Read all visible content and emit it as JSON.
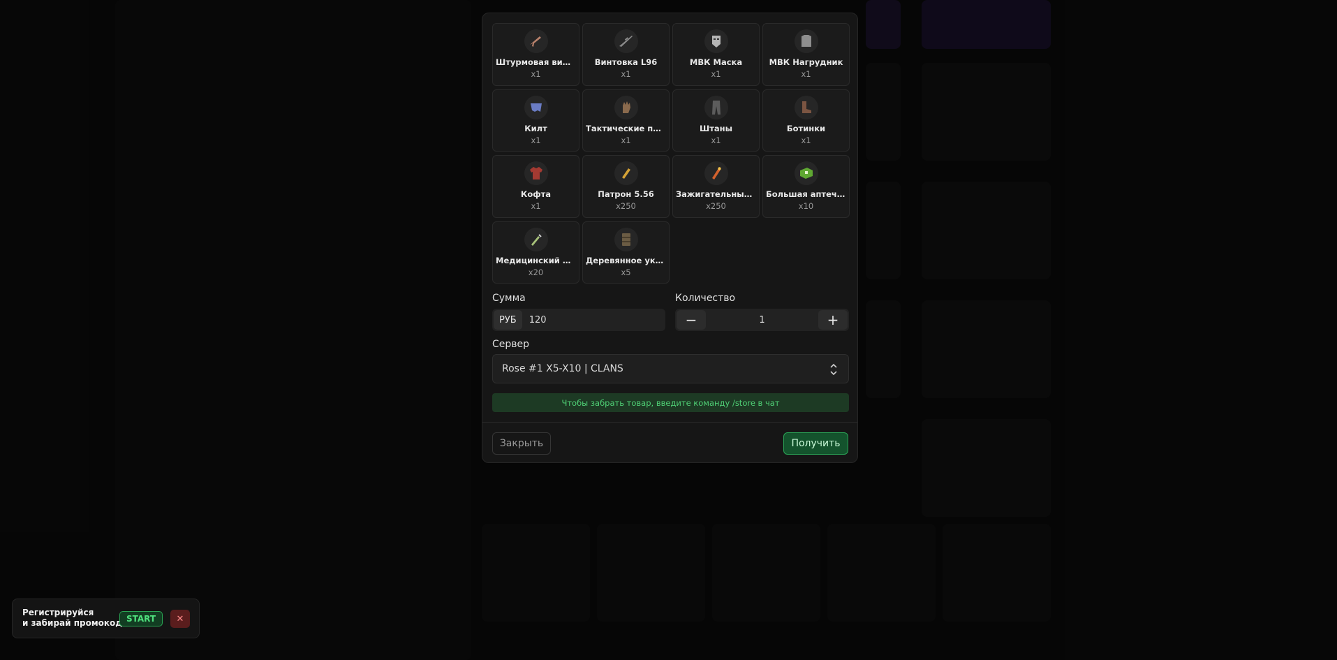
{
  "items": [
    {
      "name": "Штурмовая винто...",
      "qty": "x1",
      "icon": "rifle-icon",
      "color": "#b9826c"
    },
    {
      "name": "Винтовка L96",
      "qty": "x1",
      "icon": "sniper-rifle-icon",
      "color": "#8a8a8a"
    },
    {
      "name": "МВК Маска",
      "qty": "x1",
      "icon": "metal-mask-icon",
      "color": "#b5b5b5"
    },
    {
      "name": "МВК Нагрудник",
      "qty": "x1",
      "icon": "chestplate-icon",
      "color": "#8e8e8e"
    },
    {
      "name": "Килт",
      "qty": "x1",
      "icon": "kilt-icon",
      "color": "#6a7cc4"
    },
    {
      "name": "Тактические пер...",
      "qty": "x1",
      "icon": "gloves-icon",
      "color": "#8a6a4d"
    },
    {
      "name": "Штаны",
      "qty": "x1",
      "icon": "pants-icon",
      "color": "#5c5c5c"
    },
    {
      "name": "Ботинки",
      "qty": "x1",
      "icon": "boots-icon",
      "color": "#7b5542"
    },
    {
      "name": "Кофта",
      "qty": "x1",
      "icon": "jacket-icon",
      "color": "#a43a32"
    },
    {
      "name": "Патрон 5.56",
      "qty": "x250",
      "icon": "ammo-icon",
      "color": "#d4a236"
    },
    {
      "name": "Зажигательный п...",
      "qty": "x250",
      "icon": "incendiary-ammo-icon",
      "color": "#d2612d"
    },
    {
      "name": "Большая аптечка",
      "qty": "x10",
      "icon": "medkit-icon",
      "color": "#5fa832"
    },
    {
      "name": "Медицинский шп...",
      "qty": "x20",
      "icon": "syringe-icon",
      "color": "#a8c27a"
    },
    {
      "name": "Деревянное укр...",
      "qty": "x5",
      "icon": "wooden-barricade-icon",
      "color": "#6b5c44"
    }
  ],
  "form": {
    "sum_label": "Сумма",
    "currency": "РУБ",
    "price": "120",
    "quantity_label": "Количество",
    "quantity": "1",
    "minus": "−",
    "plus": "+",
    "server_label": "Сервер",
    "server_value": "Rose #1 X5-X10 | CLANS",
    "hint": "Чтобы забрать товар, введите команду /store в чат"
  },
  "actions": {
    "close_label": "Закрыть",
    "get_label": "Получить"
  },
  "promo": {
    "line1": "Регистрируйся",
    "line2": "и забирай промокод",
    "code": "START",
    "close": "✕"
  },
  "colors": {
    "accent_green": "#29a553",
    "hint_text": "#4fcf75",
    "close_red": "#5a1d1d"
  }
}
